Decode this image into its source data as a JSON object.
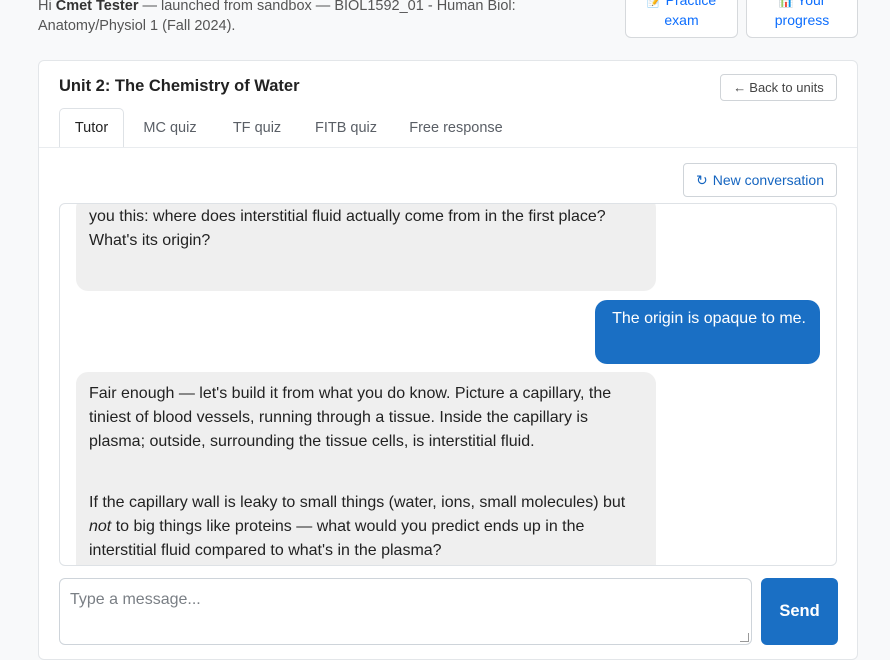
{
  "header": {
    "greeting_prefix": "Hi ",
    "user_name": "Cmet Tester",
    "greeting_suffix": " — launched from sandbox — BIOL1592_01 - Human Biol: Anatomy/Physiol 1 (Fall 2024).",
    "practice_exam": {
      "icon": "📝",
      "line1": "Practice",
      "line2": "exam"
    },
    "your_progress": {
      "icon": "📊",
      "line1": "Your",
      "line2": "progress"
    }
  },
  "unit": {
    "title": "Unit 2: The Chemistry of Water",
    "back_label": "Back to units",
    "back_arrow": "←"
  },
  "tabs": [
    {
      "label": "Tutor",
      "active": true
    },
    {
      "label": "MC quiz"
    },
    {
      "label": "TF quiz"
    },
    {
      "label": "FITB quiz"
    },
    {
      "label": "Free response"
    }
  ],
  "new_conversation": {
    "icon": "↻",
    "label": "New conversation"
  },
  "messages": [
    {
      "role": "tutor",
      "paragraphs": [
        "you this: where does interstitial fluid actually come from in the first place? What's its origin?"
      ]
    },
    {
      "role": "user",
      "paragraphs": [
        "The origin is opaque to me."
      ]
    },
    {
      "role": "tutor",
      "paragraphs": [
        "Fair enough — let's build it from what you do know. Picture a capillary, the tiniest of blood vessels, running through a tissue. Inside the capillary is plasma; outside, surrounding the tissue cells, is interstitial fluid.",
        "If the capillary wall is leaky to small things (water, ions, small molecules) but ",
        "not",
        " to big things like proteins — what would you predict ends up in the interstitial fluid compared to what's in the plasma?"
      ]
    }
  ],
  "composer": {
    "placeholder": "Type a message..."
  },
  "send_label": "Send"
}
